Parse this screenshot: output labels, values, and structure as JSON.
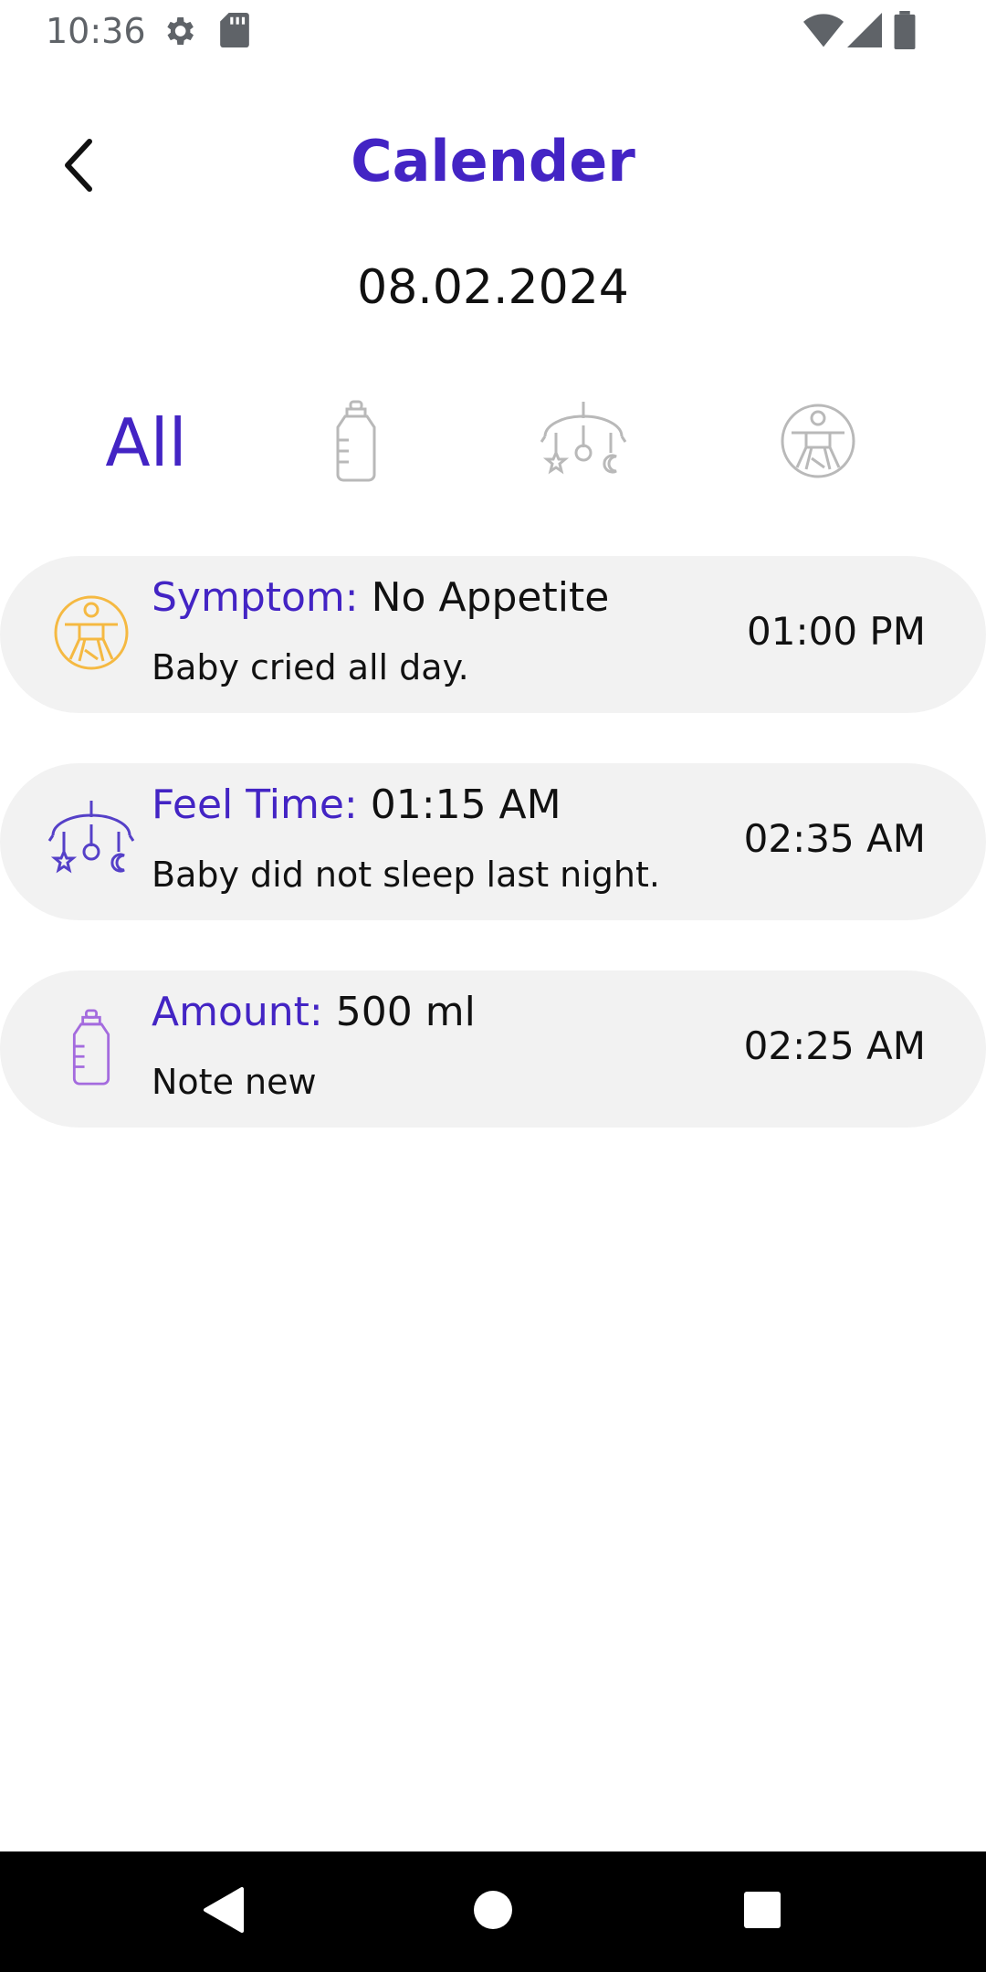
{
  "status_bar": {
    "time": "10:36",
    "icons": [
      "settings-icon",
      "sd-card-icon",
      "wifi-icon",
      "signal-icon",
      "battery-icon"
    ]
  },
  "header": {
    "title": "Calender",
    "back_icon": "chevron-left-icon"
  },
  "date": "08.02.2024",
  "filter_tabs": [
    {
      "label": "All",
      "selected": true
    },
    {
      "icon": "bottle-icon",
      "selected": false
    },
    {
      "icon": "crib-mobile-icon",
      "selected": false
    },
    {
      "icon": "baby-activity-icon",
      "selected": false
    }
  ],
  "entries": [
    {
      "type": "symptom",
      "icon": "baby-activity-icon",
      "label": "Symptom:",
      "value": "No Appetite",
      "note": "Baby cried all day.",
      "time": "01:00 PM",
      "icon_color": "#f5b942"
    },
    {
      "type": "sleep",
      "icon": "crib-mobile-icon",
      "label": "Feel Time:",
      "value": "01:15 AM",
      "note": "Baby did not sleep last night.",
      "time": "02:35 AM",
      "icon_color": "#5540c8"
    },
    {
      "type": "feeding",
      "icon": "bottle-icon",
      "label": "Amount:",
      "value": "500 ml",
      "note": "Note new",
      "time": "02:25 AM",
      "icon_color": "#a46bde"
    }
  ],
  "colors": {
    "accent": "#4324c4",
    "card_bg": "#f2f2f2",
    "inactive_icon": "#b9b9b9"
  },
  "nav_bar": {
    "icons": [
      "back-triangle-icon",
      "home-circle-icon",
      "recents-square-icon"
    ]
  }
}
